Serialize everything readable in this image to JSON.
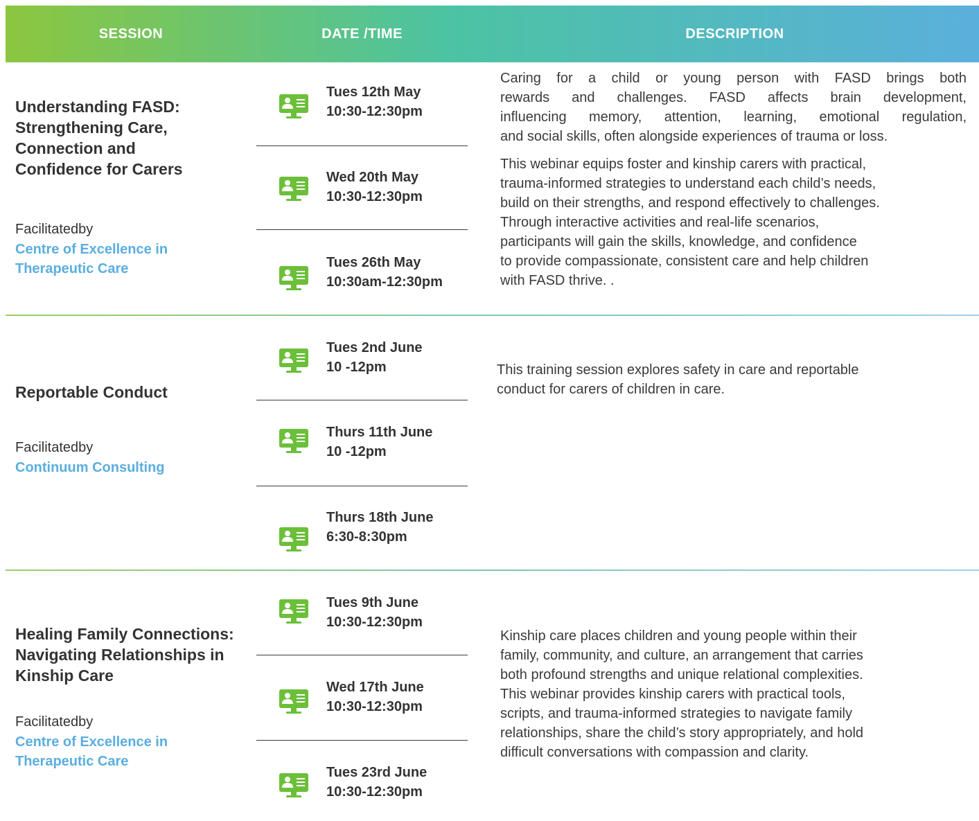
{
  "header": {
    "session": "SESSION",
    "datetime": "DATE /TIME",
    "description": "DESCRIPTION"
  },
  "colors": {
    "header_gradient": [
      "#8cc63f",
      "#4cc3a2",
      "#5ab0dc"
    ],
    "icon_green": "#6cbf3a",
    "org_blue": "#5aaee0"
  },
  "icons": {
    "session_icon": "computer-monitor-person-icon"
  },
  "sessions": [
    {
      "title_lines": [
        "Understanding FASD:",
        "Strengthening Care,",
        "Connection and",
        "Confidence for Carers"
      ],
      "facilitated_label": "Facilitatedby",
      "facilitator_lines": [
        "Centre of Excellence in",
        "Therapeutic Care"
      ],
      "dates": [
        {
          "day": "Tues 12th May",
          "time": "10:30-12:30pm"
        },
        {
          "day": "Wed 20th May",
          "time": "10:30-12:30pm"
        },
        {
          "day": "Tues 26th May",
          "time": "10:30am-12:30pm"
        }
      ],
      "description_justified": [
        "Caring for a child or young person with FASD brings both",
        "rewards and challenges. FASD affects brain development,",
        "influencing memory, attention, learning, emotional regulation,"
      ],
      "description_lines": [
        "and social skills, often alongside experiences of trauma or loss.",
        "This webinar equips foster and kinship carers with practical,",
        "trauma-informed strategies to understand each child’s needs,",
        "build on their strengths, and respond effectively to challenges.",
        "Through interactive activities and real-life scenarios,",
        "participants will gain the skills, knowledge, and confidence",
        "to provide compassionate, consistent care and help children",
        "with FASD thrive. ."
      ]
    },
    {
      "title_lines": [
        "Reportable Conduct"
      ],
      "facilitated_label": "Facilitatedby",
      "facilitator_lines": [
        "Continuum Consulting"
      ],
      "dates": [
        {
          "day": "Tues 2nd June",
          "time": "10 -12pm"
        },
        {
          "day": "Thurs 11th June",
          "time": "10 -12pm"
        },
        {
          "day": "Thurs 18th June",
          "time": "6:30-8:30pm"
        }
      ],
      "description_lines": [
        "This training session explores safety in care and reportable",
        "conduct for carers of children in care."
      ]
    },
    {
      "title_lines": [
        "Healing Family Connections:",
        "Navigating Relationships in",
        "Kinship Care"
      ],
      "facilitated_label": "Facilitatedby",
      "facilitator_lines": [
        "Centre of Excellence in",
        "Therapeutic Care"
      ],
      "dates": [
        {
          "day": "Tues 9th June",
          "time": "10:30-12:30pm"
        },
        {
          "day": "Wed  17th  June",
          "time": "10:30-12:30pm"
        },
        {
          "day": "Tues 23rd June",
          "time": "10:30-12:30pm"
        }
      ],
      "description_lines": [
        "Kinship care places children and young people within their",
        "family, community, and culture, an arrangement that carries",
        "both profound strengths and unique relational complexities.",
        "This webinar provides kinship carers with practical tools,",
        "scripts, and trauma-informed strategies to navigate family",
        "relationships, share the child’s story appropriately, and hold",
        "difficult conversations with compassion and clarity."
      ]
    }
  ]
}
